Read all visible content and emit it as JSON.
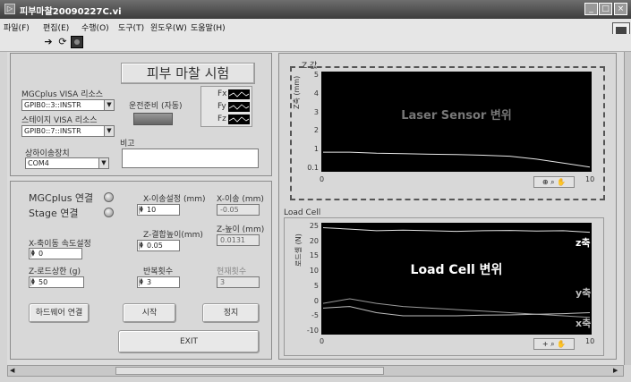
{
  "window": {
    "title": "피부마찰20090227C.vi"
  },
  "menu": [
    "파일(F)",
    "편집(E)",
    "수행(O)",
    "도구(T)",
    "윈도우(W)",
    "도움말(H)"
  ],
  "toolbar": {
    "run_icon": "run-arrow-icon",
    "continuous_icon": "run-continuous-icon",
    "abort_icon": "abort-stop-icon"
  },
  "header": {
    "title": "피부 마찰 시험"
  },
  "visa": {
    "mgc_label": "MGCplus VISA 리소스",
    "mgc_value": "GPIB0::3::INSTR",
    "stage_label": "스테이지 VISA 리소스",
    "stage_value": "GPIB0::7::INSTR",
    "ready_label": "운전준비 (자동)"
  },
  "force_legend": [
    "Fx",
    "Fy",
    "Fz"
  ],
  "serial": {
    "label": "상하이송장치",
    "value": "COM4"
  },
  "remarks": {
    "label": "비고",
    "value": ""
  },
  "controls": {
    "mgc_connect": "MGCplus 연결",
    "stage_connect": "Stage 연결",
    "x_move_set_label": "X-이송설정 (mm)",
    "x_move_set_value": "10",
    "x_move_label": "X-이송 (mm)",
    "x_move_value": "-0.05",
    "z_press_label": "Z-결합높이(mm)",
    "z_press_value": "0.05",
    "z_height_label": "Z-높이 (mm)",
    "z_height_value": "0.0131",
    "x_speed_label": "X-축이동 속도설정",
    "x_speed_value": "0",
    "z_load_label": "Z-로드상한 (g)",
    "z_load_value": "50",
    "repeat_label": "반복횟수",
    "repeat_value": "3",
    "current_label": "현재횟수",
    "current_value": "3"
  },
  "buttons": {
    "hw_connect": "하드웨어 연결",
    "start": "시작",
    "stop": "정지",
    "exit": "EXIT"
  },
  "graph_z": {
    "title": "Z 값",
    "ylabel": "Z축 (mm)",
    "overlay": "Laser Sensor 변위",
    "yticks": [
      "5",
      "4",
      "3",
      "2",
      "1",
      "0.1"
    ],
    "xticks": [
      "0",
      "10"
    ]
  },
  "graph_load": {
    "title": "Load Cell",
    "ylabel": "로드셀 (N)",
    "overlay": "Load Cell 변위",
    "yticks": [
      "25",
      "20",
      "15",
      "10",
      "5",
      "0",
      "-5",
      "-10"
    ],
    "xticks": [
      "0",
      "10"
    ],
    "series_labels": [
      "z축",
      "y축",
      "x축"
    ]
  },
  "chart_data": [
    {
      "type": "line",
      "title": "Z 값",
      "ylabel": "Z축 (mm)",
      "xlim": [
        0,
        10
      ],
      "ylim": [
        0.1,
        5
      ],
      "x": [
        0,
        1,
        2,
        3,
        4,
        5,
        6,
        7,
        8,
        9,
        10
      ],
      "series": [
        {
          "values": [
            1.0,
            1.0,
            0.95,
            0.93,
            0.9,
            0.88,
            0.85,
            0.8,
            0.65,
            0.45,
            0.25
          ]
        }
      ]
    },
    {
      "type": "line",
      "title": "Load Cell",
      "ylabel": "로드셀 (N)",
      "xlim": [
        0,
        10
      ],
      "ylim": [
        -10,
        25
      ],
      "x": [
        0,
        1,
        2,
        3,
        4,
        5,
        6,
        7,
        8,
        9,
        10
      ],
      "series": [
        {
          "name": "z축",
          "values": [
            24,
            23.5,
            23,
            23.2,
            23,
            22.8,
            23,
            23.1,
            22.9,
            23,
            22.5
          ]
        },
        {
          "name": "y축",
          "values": [
            -0.5,
            1,
            -0.5,
            -1.5,
            -2,
            -2.5,
            -3,
            -3.5,
            -4,
            -4.5,
            -5
          ]
        },
        {
          "name": "x축",
          "values": [
            -2,
            -1.5,
            -3.5,
            -4.5,
            -4.5,
            -4.5,
            -4.3,
            -4.2,
            -4,
            -3.8,
            -3.5
          ]
        }
      ]
    }
  ]
}
